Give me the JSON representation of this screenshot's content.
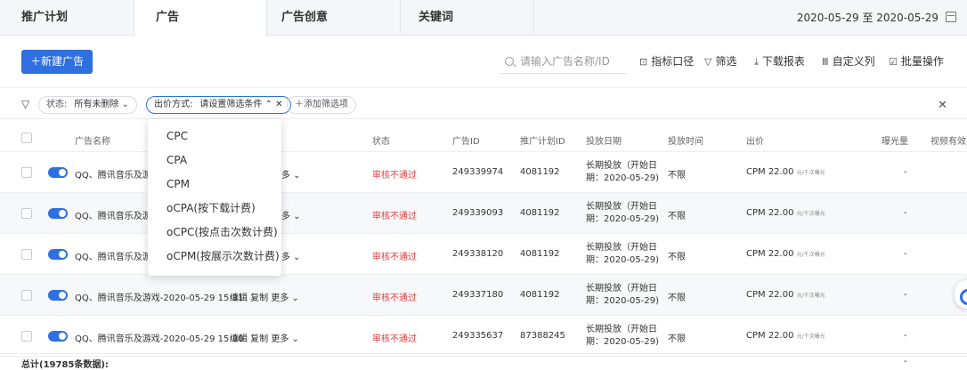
{
  "tabs": [
    {
      "label": "推广计划"
    },
    {
      "label": "广告"
    },
    {
      "label": "广告创意"
    },
    {
      "label": "关键词"
    }
  ],
  "date_range": "2020-05-29 至 2020-05-29",
  "toolbar": {
    "new_ad": "＋新建广告",
    "search_placeholder": "请输入广告名称/ID",
    "metric": "指标口径",
    "filter": "筛选",
    "download": "下载报表",
    "custom_columns": "自定义列",
    "batch": "批量操作"
  },
  "filters": {
    "status_label": "状态:",
    "status_value": "所有未删除",
    "bid_label": "出价方式:",
    "bid_value": "请设置筛选条件",
    "add": "＋添加筛选项"
  },
  "bid_options": [
    "CPC",
    "CPA",
    "CPM",
    "oCPA(按下载计费)",
    "oCPC(按点击次数计费)",
    "oCPM(按展示次数计费)"
  ],
  "columns": {
    "name": "广告名称",
    "status": "状态",
    "ad_id": "广告ID",
    "plan_id": "推广计划ID",
    "date": "投放日期",
    "time": "投放时间",
    "bid": "出价",
    "exposure": "曝光量",
    "video": "视频有效"
  },
  "rows": [
    {
      "name": "QQ、腾讯音乐及游戏",
      "actions": "多 ⌄",
      "status": "审核不通过",
      "ad_id": "249339974",
      "plan_id": "4081192",
      "date1": "长期投放（开始日",
      "date2": "期：2020-05-29)",
      "time": "不限",
      "bid": "CPM 22.00",
      "bid_unit": "元/千次曝光",
      "exposure": "-"
    },
    {
      "name": "QQ、腾讯音乐及游戏",
      "actions": "多 ⌄",
      "status": "审核不通过",
      "ad_id": "249339093",
      "plan_id": "4081192",
      "date1": "长期投放（开始日",
      "date2": "期：2020-05-29)",
      "time": "不限",
      "bid": "CPM 22.00",
      "bid_unit": "元/千次曝光",
      "exposure": "-"
    },
    {
      "name": "QQ、腾讯音乐及游",
      "actions": "多 ⌄",
      "status": "审核不通过",
      "ad_id": "249338120",
      "plan_id": "4081192",
      "date1": "长期投放（开始日",
      "date2": "期：2020-05-29)",
      "time": "不限",
      "bid": "CPM 22.00",
      "bid_unit": "元/千次曝光",
      "exposure": "-"
    },
    {
      "name": "QQ、腾讯音乐及游戏-2020-05-29 15:31",
      "actions": "编辑  复制  更多 ⌄",
      "status": "审核不通过",
      "ad_id": "249337180",
      "plan_id": "4081192",
      "date1": "长期投放（开始日",
      "date2": "期：2020-05-29)",
      "time": "不限",
      "bid": "CPM 22.00",
      "bid_unit": "元/千次曝光",
      "exposure": "-"
    },
    {
      "name": "QQ、腾讯音乐及游戏-2020-05-29 15:30",
      "actions": "编辑  复制  更多 ⌄",
      "status": "审核不通过",
      "ad_id": "249335637",
      "plan_id": "87388245",
      "date1": "长期投放（开始日",
      "date2": "期：2020-05-29)",
      "time": "不限",
      "bid": "CPM 22.00",
      "bid_unit": "元/千次曝光",
      "exposure": "-"
    }
  ],
  "footer": {
    "total": "总计(19785条数据):",
    "exposure": "-"
  }
}
